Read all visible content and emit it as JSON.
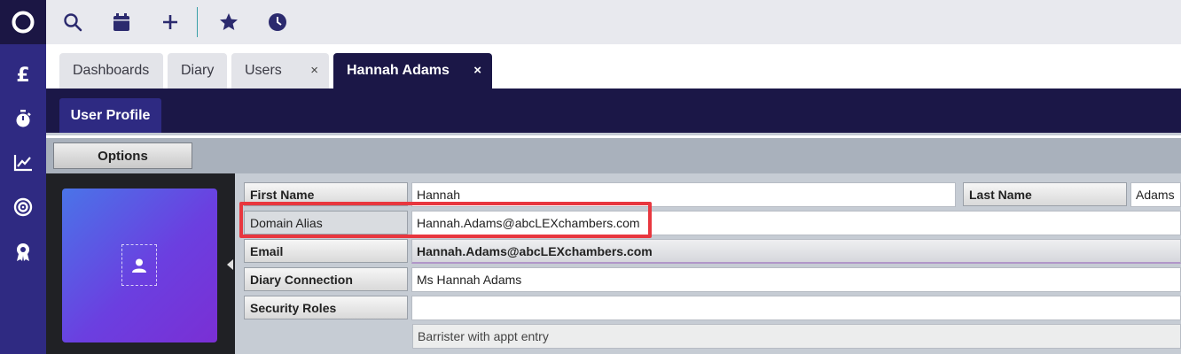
{
  "sidebar": {
    "logo_icon": "ring-logo-icon",
    "items": [
      {
        "name": "finance",
        "icon": "pound-icon",
        "glyph": "£"
      },
      {
        "name": "timer",
        "icon": "stopwatch-icon"
      },
      {
        "name": "reports",
        "icon": "line-chart-icon"
      },
      {
        "name": "targets",
        "icon": "target-icon"
      },
      {
        "name": "awards",
        "icon": "award-icon"
      }
    ],
    "color": "#2f2a82"
  },
  "toolbar": {
    "buttons": [
      {
        "name": "search",
        "icon": "search-icon"
      },
      {
        "name": "calendar",
        "icon": "calendar-icon"
      },
      {
        "name": "add",
        "icon": "plus-icon"
      },
      {
        "name": "favourites",
        "icon": "star-icon"
      },
      {
        "name": "recent",
        "icon": "clock-icon"
      }
    ],
    "icon_color": "#2b2a6e"
  },
  "tabs": [
    {
      "label": "Dashboards",
      "closable": false,
      "active": false
    },
    {
      "label": "Diary",
      "closable": false,
      "active": false
    },
    {
      "label": "Users",
      "closable": true,
      "active": false
    },
    {
      "label": "Hannah Adams",
      "closable": true,
      "active": true
    }
  ],
  "close_glyph": "×",
  "subtabs": [
    {
      "label": "User Profile",
      "active": true
    }
  ],
  "options": {
    "label": "Options"
  },
  "profile": {
    "avatar_icon": "user-placeholder-icon",
    "fields": {
      "first_name": {
        "label": "First Name",
        "value": "Hannah"
      },
      "last_name": {
        "label": "Last Name",
        "value": "Adams"
      },
      "domain_alias": {
        "label": "Domain Alias",
        "value": "Hannah.Adams@abcLEXchambers.com"
      },
      "email": {
        "label": "Email",
        "value": "Hannah.Adams@abcLEXchambers.com"
      },
      "diary_connection": {
        "label": "Diary Connection",
        "value": "Ms Hannah Adams"
      },
      "security_roles": {
        "label": "Security Roles",
        "value": "",
        "role": "Barrister with appt entry"
      }
    }
  },
  "colors": {
    "accent_dark": "#1b1747",
    "highlight": "#e8373f"
  }
}
